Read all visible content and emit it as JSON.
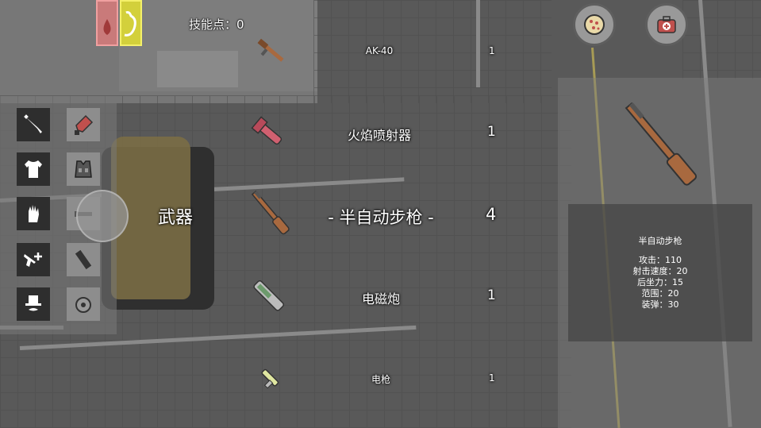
{
  "hud": {
    "skill_points": "技能点：0",
    "category_label": "武器",
    "stat_icons": [
      "blood-drop-icon",
      "stomach-icon"
    ]
  },
  "equipment_slots": [
    {
      "name": "knife-slot",
      "icon": "knife-icon"
    },
    {
      "name": "chainsaw-slot",
      "icon": "chainsaw-icon"
    },
    {
      "name": "shirt-slot",
      "icon": "shirt-icon"
    },
    {
      "name": "armor-slot",
      "icon": "armor-vest-icon"
    },
    {
      "name": "glove-slot",
      "icon": "glove-icon"
    },
    {
      "name": "scope-slot",
      "icon": "scope-icon"
    },
    {
      "name": "pistol-slot",
      "icon": "pistol-icon"
    },
    {
      "name": "magazine-slot",
      "icon": "magazine-icon"
    },
    {
      "name": "disguise-slot",
      "icon": "hat-mustache-icon"
    },
    {
      "name": "turbine-slot",
      "icon": "turbine-icon"
    }
  ],
  "weapons": [
    {
      "name": "AK-40",
      "count": "1",
      "icon": "ak-rifle-icon"
    },
    {
      "name": "火焰喷射器",
      "count": "1",
      "icon": "flamethrower-icon"
    },
    {
      "name": "- 半自动步枪 -",
      "count": "4",
      "icon": "semi-auto-rifle-icon",
      "selected": true
    },
    {
      "name": "电磁炮",
      "count": "1",
      "icon": "railgun-icon"
    },
    {
      "name": "电枪",
      "count": "1",
      "icon": "taser-icon"
    }
  ],
  "buttons": {
    "food": "pizza-icon",
    "medkit": "medkit-icon"
  },
  "selected_weapon": {
    "title": "半自动步枪",
    "stats": [
      "攻击：110",
      "射击速度：20",
      "后坐力：15",
      "范围：20",
      "装弹：30"
    ]
  },
  "colors": {
    "blood": "#c97a7a",
    "hunger": "#d3d03b",
    "rifle_wood": "#a8693f"
  }
}
